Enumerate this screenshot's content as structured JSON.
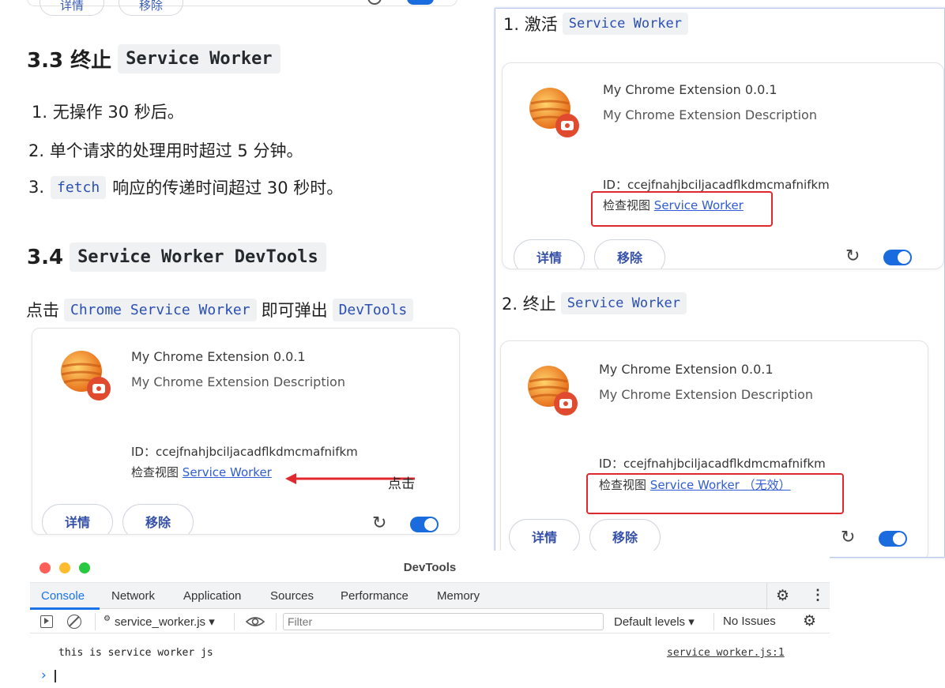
{
  "top_clipped": {
    "btn1": "详情",
    "btn2": "移除"
  },
  "section_33": {
    "number": "3.3 终止",
    "code": "Service Worker",
    "items": [
      {
        "num": "1.",
        "text": "无操作 30 秒后。"
      },
      {
        "num": "2.",
        "text": "单个请求的处理用时超过 5 分钟。"
      },
      {
        "num": "3.",
        "code": "fetch",
        "text": "响应的传递时间超过 30 秒时。"
      }
    ]
  },
  "section_34": {
    "number": "3.4",
    "code": "Service Worker DevTools",
    "intro_prefix": "点击",
    "intro_code1": "Chrome Service Worker",
    "intro_mid": "即可弹出",
    "intro_code2": "DevTools"
  },
  "left_card": {
    "name": "My Chrome Extension  0.0.1",
    "desc": "My Chrome Extension Description",
    "id": "ID：ccejfnahjbciljacadflkdmcmafnifkm",
    "inspect_label": "检查视图",
    "inspect_link": "Service Worker",
    "arrow_label": "点击",
    "details_btn": "详情",
    "remove_btn": "移除"
  },
  "right_panel": {
    "step1_label": "1. 激活",
    "step1_code": "Service Worker",
    "step2_label": "2. 终止",
    "step2_code": "Service Worker",
    "card1": {
      "name": "My Chrome Extension  0.0.1",
      "desc": "My Chrome Extension Description",
      "id": "ID：ccejfnahjbciljacadflkdmcmafnifkm",
      "inspect_label": "检查视图",
      "inspect_link": "Service Worker",
      "details_btn": "详情",
      "remove_btn": "移除"
    },
    "card2": {
      "name": "My Chrome Extension  0.0.1",
      "desc": "My Chrome Extension Description",
      "id": "ID：ccejfnahjbciljacadflkdmcmafnifkm",
      "inspect_label": "检查视图",
      "inspect_link": "Service Worker （无效）",
      "details_btn": "详情",
      "remove_btn": "移除"
    }
  },
  "devtools": {
    "title": "DevTools",
    "tabs": [
      "Console",
      "Network",
      "Application",
      "Sources",
      "Performance",
      "Memory"
    ],
    "context": "service_worker.js ▾",
    "filter_placeholder": "Filter",
    "levels": "Default levels ▾",
    "issues": "No Issues",
    "log_message": "this is service worker js",
    "log_source": "service worker.js:1",
    "prompt": "›"
  },
  "colors": {
    "accent": "#2f5bd6",
    "highlight": "#e0282e",
    "toggle": "#1a6bdd"
  }
}
